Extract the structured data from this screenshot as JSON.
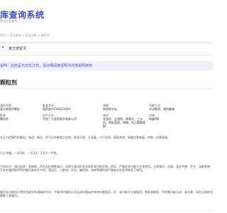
{
  "header": {
    "title": "库查询系统",
    "subtitle": "药品信息查询"
  },
  "breadcrumb": "首页 > 药品查询 > 药品详情 > 说明书",
  "search": {
    "select_label": "▾",
    "value": "复方感冒灵"
  },
  "notice": {
    "text": "说明：此药品为非处方药，请仔细阅读说明书并按说明使用"
  },
  "drug": {
    "title": "颗粒剂",
    "fields": [
      {
        "label": "通用名称",
        "value": "复方感冒灵颗粒"
      },
      {
        "label": "批准文号",
        "value": "国药准字Z44021940"
      },
      {
        "label": "规格",
        "value": "每袋装14g"
      },
      {
        "label": "功能主治",
        "value": "辛凉解表，清热解毒"
      },
      {
        "label": "剂型",
        "value": "颗粒剂"
      },
      {
        "label": "生产企业",
        "value": "华润三九医药股份有限公司"
      },
      {
        "label": "成份",
        "value": "金银花、五指柑、野菊花、三叉苦、南板蓝根、岗梅、对乙酰氨基酚"
      },
      {
        "label": "包装",
        "value": "每盒9袋"
      }
    ],
    "para1": "本品为棕黄色的颗粒；味甜、微苦。用于风热感冒之发热，微恶风寒，头身痛，口干而渴，鼻塞涕浊，咽喉红肿疼痛，咳嗽，痰黄粘稠。",
    "para2": "开水冲服。一次1袋，一日3次；2天为一疗程。",
    "para3": "不良反应：偶见皮疹、荨麻疹、药热及粒细胞减少；长期大量用药会导致肝肾功能异常。禁忌：严重肝肾功能不全者禁用。注意事项：忌烟、酒及辛辣、生冷、油腻食物；不宜在服药期间同时服用滋补性中药；高血压、心脏病、肝病、糖尿病、肾病等慢性病严重者应在医师指导下服用。",
    "para4": "服用本品期间不得饮酒或含有酒精的饮料；不能同时服用与本品成份相似的其他抗感冒药；肝、肾功能不全者慎用；膀胱颈梗阻、甲状腺功能亢进、青光眼、高血压和前列腺肥大者慎用。"
  },
  "colors": {
    "accent": "#3c4fc4",
    "notice_bg": "#eef1fb",
    "notice_text": "#3a57d6"
  }
}
